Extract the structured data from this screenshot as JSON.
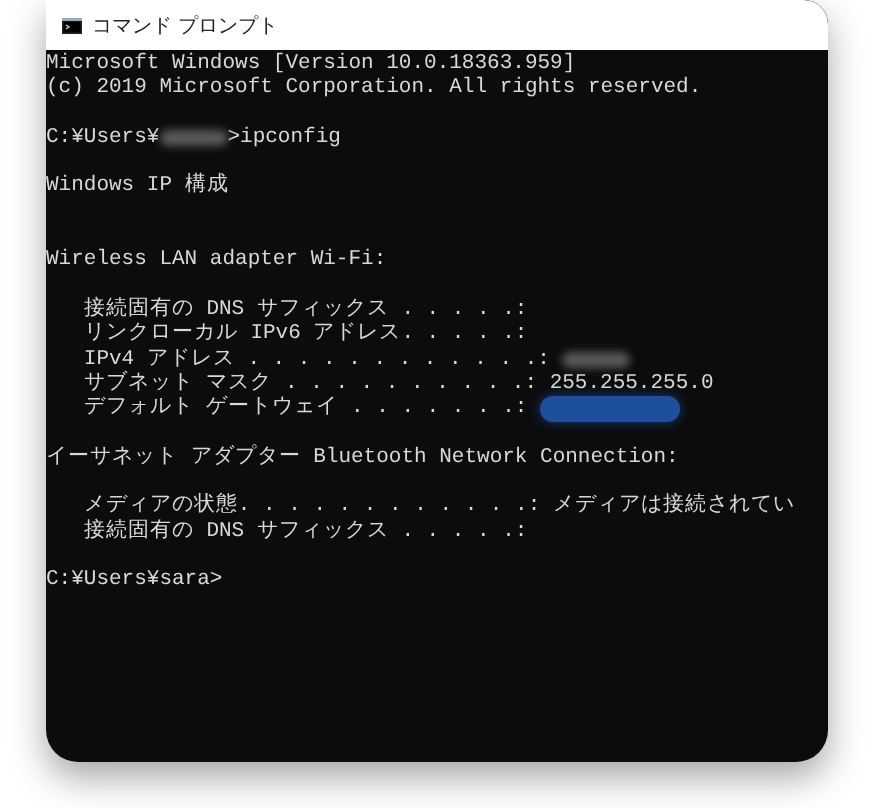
{
  "window": {
    "title": "コマンド プロンプト"
  },
  "console": {
    "lines": [
      {
        "kind": "text",
        "text": "Microsoft Windows [Version 10.0.18363.959]"
      },
      {
        "kind": "text",
        "text": "(c) 2019 Microsoft Corporation. All rights reserved."
      },
      {
        "kind": "blank"
      },
      {
        "kind": "masked",
        "before": "C:¥Users¥",
        "highlighted": false,
        "after": ">ipconfig"
      },
      {
        "kind": "blank"
      },
      {
        "kind": "text",
        "text": "Windows IP 構成"
      },
      {
        "kind": "blank"
      },
      {
        "kind": "blank"
      },
      {
        "kind": "text",
        "text": "Wireless LAN adapter Wi-Fi:"
      },
      {
        "kind": "blank"
      },
      {
        "kind": "text",
        "text": "   接続固有の DNS サフィックス . . . . .:"
      },
      {
        "kind": "text",
        "text": "   リンクローカル IPv6 アドレス. . . . .:"
      },
      {
        "kind": "masked",
        "before": "   IPv4 アドレス . . . . . . . . . . . .: ",
        "highlighted": false
      },
      {
        "kind": "text",
        "text": "   サブネット マスク . . . . . . . . . .: 255.255.255.0"
      },
      {
        "kind": "masked",
        "before": "   デフォルト ゲートウェイ . . . . . . .: ",
        "highlighted": true
      },
      {
        "kind": "blank"
      },
      {
        "kind": "text",
        "text": "イーサネット アダプター Bluetooth Network Connection:"
      },
      {
        "kind": "blank"
      },
      {
        "kind": "text",
        "text": "   メディアの状態. . . . . . . . . . . .: メディアは接続されてい"
      },
      {
        "kind": "text",
        "text": "   接続固有の DNS サフィックス . . . . .:"
      },
      {
        "kind": "blank"
      },
      {
        "kind": "text",
        "text": "C:¥Users¥sara>"
      }
    ]
  }
}
